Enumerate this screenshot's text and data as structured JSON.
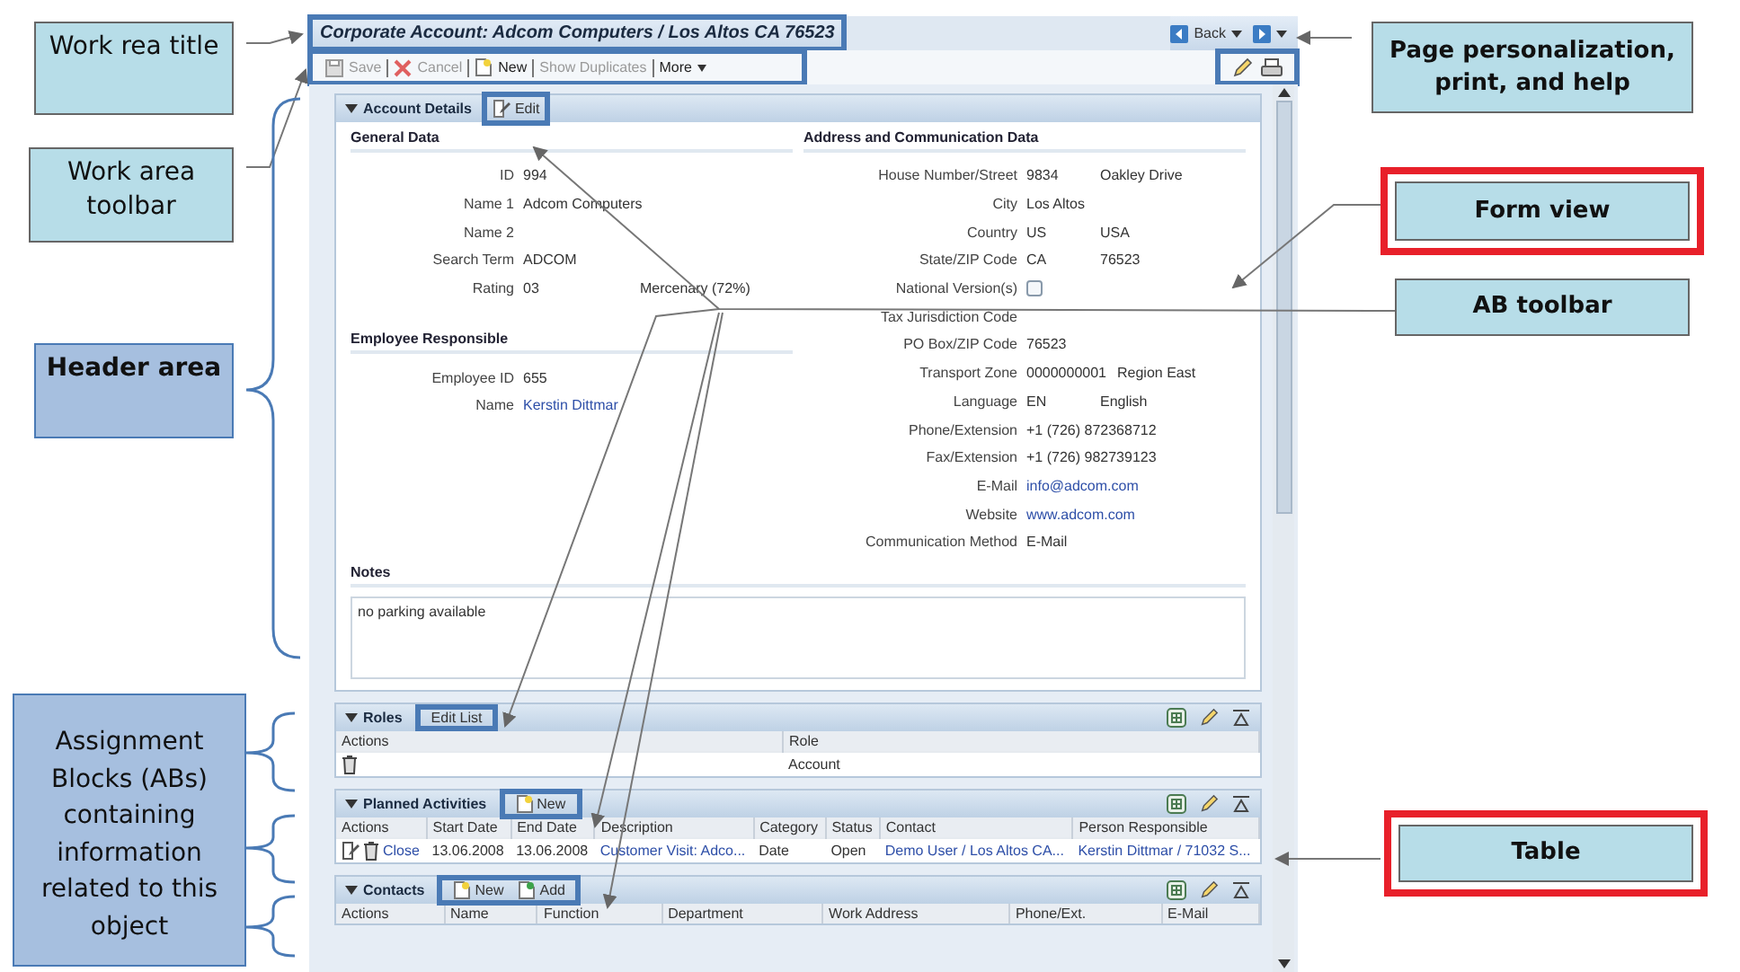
{
  "left_callouts": [
    {
      "text": "Work rea title",
      "color": "#b7dde8"
    },
    {
      "text": "Work area toolbar",
      "color": "#b7dde8"
    },
    {
      "text": "Header area",
      "color": "#a6bfdf"
    },
    {
      "text": "Assignment Blocks (ABs) containing information related to this object",
      "color": "#a6bfdf"
    }
  ],
  "right_callouts": [
    {
      "text": "Page personalization, print, and help",
      "highlighted": false
    },
    {
      "text": "Form view",
      "highlighted": true
    },
    {
      "text": "AB toolbar",
      "highlighted": false
    },
    {
      "text": "Table",
      "highlighted": true
    }
  ],
  "window": {
    "title": "Corporate Account: Adcom Computers / Los Altos CA 76523",
    "back": "Back"
  },
  "toolbar": [
    {
      "label": "Save",
      "disabled": true,
      "kind": "save"
    },
    {
      "label": "Cancel",
      "disabled": true,
      "kind": "cancel"
    },
    {
      "label": "New",
      "disabled": false,
      "kind": "new"
    },
    {
      "label": "Show Duplicates",
      "disabled": true,
      "kind": "plain"
    },
    {
      "label": "More",
      "disabled": false,
      "kind": "menu"
    }
  ],
  "account_details": {
    "title": "Account Details",
    "edit_button": "Edit",
    "left_sections": [
      {
        "title": "General Data",
        "fields": [
          {
            "label": "ID",
            "value": "994",
            "kind": "text"
          },
          {
            "label": "Name 1",
            "value": "Adcom Computers",
            "kind": "text"
          },
          {
            "label": "Name 2",
            "kind": "text"
          },
          {
            "label": "Search Term",
            "value": "ADCOM",
            "kind": "text"
          },
          {
            "label": "Rating",
            "value": "03",
            "extra": "Mercenary (72%)",
            "kind": "text"
          }
        ]
      },
      {
        "title": "Employee Responsible",
        "fields": [
          {
            "label": "Employee ID",
            "value": "655",
            "kind": "text"
          },
          {
            "label": "Name",
            "value": "Kerstin Dittmar",
            "kind": "text",
            "link": true
          }
        ]
      }
    ],
    "right_sections": [
      {
        "title": "Address and Communication Data",
        "fields": [
          {
            "label": "House Number/Street",
            "value": "9834",
            "extra": "Oakley Drive",
            "kind": "text"
          },
          {
            "label": "City",
            "value": "Los Altos",
            "kind": "text"
          },
          {
            "label": "Country",
            "value": "US",
            "extra": "USA",
            "kind": "text"
          },
          {
            "label": "State/ZIP Code",
            "value": "CA",
            "extra": "76523",
            "kind": "text"
          },
          {
            "label": "National Version(s)",
            "kind": "checkbox",
            "checked": false
          },
          {
            "label": "Tax Jurisdiction Code",
            "kind": "text"
          },
          {
            "label": "PO Box/ZIP Code",
            "value": "76523",
            "kind": "text"
          },
          {
            "label": "Transport Zone",
            "value": "0000000001",
            "extra": "Region East",
            "kind": "text"
          },
          {
            "label": "Language",
            "value": "EN",
            "extra": "English",
            "kind": "text"
          },
          {
            "label": "Phone/Extension",
            "value": "+1 (726) 872368712",
            "kind": "text"
          },
          {
            "label": "Fax/Extension",
            "value": "+1 (726) 982739123",
            "kind": "text"
          },
          {
            "label": "E-Mail",
            "value": "info@adcom.com",
            "kind": "text",
            "link": true
          },
          {
            "label": "Website",
            "value": "www.adcom.com",
            "kind": "text",
            "link": true
          },
          {
            "label": "Communication Method",
            "value": "E-Mail",
            "kind": "text"
          }
        ]
      }
    ],
    "notes": {
      "title": "Notes",
      "value": "no parking available"
    }
  },
  "blocks": [
    {
      "title": "Roles",
      "buttons": [
        {
          "label": "Edit List",
          "kind": "plain"
        }
      ],
      "columns": [
        "Actions",
        "Role"
      ],
      "rows": [
        [
          {
            "kind": "actions"
          },
          {
            "kind": "text",
            "text": "Account"
          }
        ]
      ]
    },
    {
      "title": "Planned Activities",
      "buttons": [
        {
          "label": "New",
          "kind": "new"
        }
      ],
      "columns": [
        "Actions",
        "Start Date",
        "End Date",
        "Description",
        "Category",
        "Status",
        "Contact",
        "Person Responsible"
      ],
      "rows": [
        [
          {
            "kind": "actions",
            "editable": true,
            "text": "Close"
          },
          {
            "kind": "text",
            "text": "13.06.2008"
          },
          {
            "kind": "text",
            "text": "13.06.2008"
          },
          {
            "kind": "text",
            "text": "Customer Visit: Adco...",
            "link": true
          },
          {
            "kind": "text",
            "text": "Date"
          },
          {
            "kind": "text",
            "text": "Open"
          },
          {
            "kind": "text",
            "text": "Demo User / Los Altos CA...",
            "link": true
          },
          {
            "kind": "text",
            "text": "Kerstin Dittmar / 71032 S...",
            "link": true
          }
        ]
      ]
    },
    {
      "title": "Contacts",
      "buttons": [
        {
          "label": "New",
          "kind": "new"
        },
        {
          "label": "Add",
          "kind": "add"
        }
      ],
      "columns": [
        "Actions",
        "Name",
        "Function",
        "Department",
        "Work Address",
        "Phone/Ext.",
        "E-Mail"
      ]
    }
  ]
}
